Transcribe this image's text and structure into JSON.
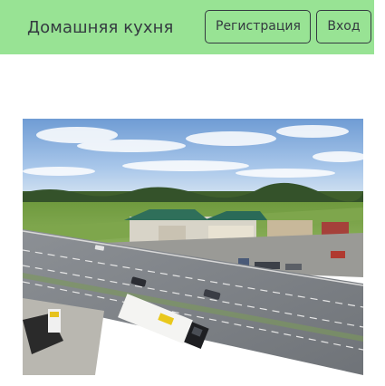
{
  "header": {
    "brand": "Домашняя кухня",
    "register_label": "Регистрация",
    "login_label": "Вход",
    "background_color": "#98e394"
  },
  "main": {
    "image": {
      "subject": "aerial-highway-roadside-complex"
    }
  }
}
